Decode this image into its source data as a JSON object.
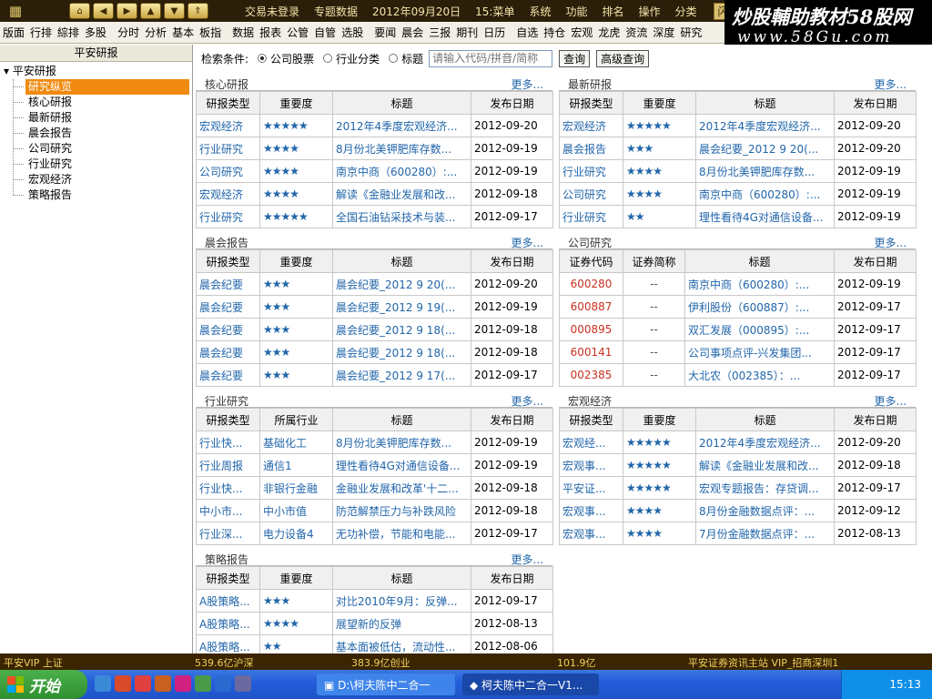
{
  "topbar": {
    "nav_icons": [
      "home-icon",
      "arrow-left-icon",
      "arrow-right-icon",
      "arrow-up-icon",
      "arrow-down-icon",
      "double-up-icon"
    ],
    "menu": [
      "交易未登录",
      "专题数据",
      "2012年09月20日",
      "15:菜单",
      "系统",
      "功能",
      "排名",
      "操作",
      "分类"
    ],
    "flash": "闪电手"
  },
  "toolbar": {
    "items": [
      "版面",
      "行排",
      "綜排",
      "多股",
      "分时",
      "分析",
      "基本",
      "板指",
      "数据",
      "报表",
      "公管",
      "自管",
      "选股",
      "要闻",
      "晨会",
      "三报",
      "期刊",
      "日历",
      "自选",
      "持仓",
      "宏观",
      "龙虎",
      "资流",
      "深度",
      "研究"
    ]
  },
  "watermark": {
    "line1": "炒股輔助教材58股网",
    "line2": "www.58Gu.com"
  },
  "sidebar": {
    "header": "平安研报",
    "root": "平安研报",
    "items": [
      "研究纵览",
      "核心研报",
      "最新研报",
      "晨会报告",
      "公司研究",
      "行业研究",
      "宏观经济",
      "策略报告"
    ],
    "selected": 0
  },
  "search": {
    "label": "检索条件:",
    "options": [
      "公司股票",
      "行业分类",
      "标题"
    ],
    "placeholder": "请输入代码/拼音/简称",
    "query_button": "查询",
    "advanced_button": "高级查询"
  },
  "panels": [
    {
      "title": "核心研报",
      "more": "更多...",
      "headers": [
        "研报类型",
        "重要度",
        "标题",
        "发布日期"
      ],
      "rows": [
        [
          "宏观经济",
          "★★★★★",
          "2012年4季度宏观经济...",
          "2012-09-20"
        ],
        [
          "行业研究",
          "★★★★",
          "8月份北美钾肥库存数...",
          "2012-09-19"
        ],
        [
          "公司研究",
          "★★★★",
          "南京中商（600280）:...",
          "2012-09-19"
        ],
        [
          "宏观经济",
          "★★★★",
          "解读《金融业发展和改...",
          "2012-09-18"
        ],
        [
          "行业研究",
          "★★★★★",
          "全国石油钻采技术与装...",
          "2012-09-17"
        ]
      ]
    },
    {
      "title": "最新研报",
      "more": "更多...",
      "headers": [
        "研报类型",
        "重要度",
        "标题",
        "发布日期"
      ],
      "rows": [
        [
          "宏观经济",
          "★★★★★",
          "2012年4季度宏观经济...",
          "2012-09-20"
        ],
        [
          "晨会报告",
          "★★★",
          "晨会纪要_2012 9 20(...",
          "2012-09-20"
        ],
        [
          "行业研究",
          "★★★★",
          "8月份北美钾肥库存数...",
          "2012-09-19"
        ],
        [
          "公司研究",
          "★★★★",
          "南京中商（600280）:...",
          "2012-09-19"
        ],
        [
          "行业研究",
          "★★",
          "理性看待4G对通信设备...",
          "2012-09-19"
        ]
      ]
    },
    {
      "title": "晨会报告",
      "more": "更多...",
      "headers": [
        "研报类型",
        "重要度",
        "标题",
        "发布日期"
      ],
      "rows": [
        [
          "晨会纪要",
          "★★★",
          "晨会纪要_2012 9 20(...",
          "2012-09-20"
        ],
        [
          "晨会纪要",
          "★★★",
          "晨会纪要_2012 9 19(...",
          "2012-09-19"
        ],
        [
          "晨会纪要",
          "★★★",
          "晨会纪要_2012 9 18(...",
          "2012-09-18"
        ],
        [
          "晨会纪要",
          "★★★",
          "晨会纪要_2012 9 18(...",
          "2012-09-18"
        ],
        [
          "晨会纪要",
          "★★★",
          "晨会纪要_2012 9 17(...",
          "2012-09-17"
        ]
      ]
    },
    {
      "title": "公司研究",
      "more": "更多...",
      "headers": [
        "证券代码",
        "证券简称",
        "标题",
        "发布日期"
      ],
      "rows": [
        [
          "600280",
          "--",
          "南京中商（600280）:...",
          "2012-09-19"
        ],
        [
          "600887",
          "--",
          "伊利股份（600887）:...",
          "2012-09-17"
        ],
        [
          "000895",
          "--",
          "双汇发展（000895）:...",
          "2012-09-17"
        ],
        [
          "600141",
          "--",
          "公司事项点评-兴发集团...",
          "2012-09-17"
        ],
        [
          "002385",
          "--",
          "大北农（002385）：...",
          "2012-09-17"
        ]
      ]
    },
    {
      "title": "行业研究",
      "more": "更多...",
      "headers": [
        "研报类型",
        "所属行业",
        "标题",
        "发布日期"
      ],
      "rows": [
        [
          "行业快...",
          "基础化工",
          "8月份北美钾肥库存数...",
          "2012-09-19"
        ],
        [
          "行业周报",
          "通信1",
          "理性看待4G对通信设备...",
          "2012-09-19"
        ],
        [
          "行业快...",
          "非银行金融",
          "金融业发展和改革'十二...",
          "2012-09-18"
        ],
        [
          "中小市...",
          "中小市值",
          "防范解禁压力与补跌风险",
          "2012-09-18"
        ],
        [
          "行业深...",
          "电力设备4",
          "无功补偿，节能和电能...",
          "2012-09-17"
        ]
      ]
    },
    {
      "title": "宏观经济",
      "more": "更多...",
      "headers": [
        "研报类型",
        "重要度",
        "标题",
        "发布日期"
      ],
      "rows": [
        [
          "宏观经...",
          "★★★★★",
          "2012年4季度宏观经济...",
          "2012-09-20"
        ],
        [
          "宏观事...",
          "★★★★★",
          "解读《金融业发展和改...",
          "2012-09-18"
        ],
        [
          "平安证...",
          "★★★★★",
          "宏观专题报告：存贷调...",
          "2012-09-17"
        ],
        [
          "宏观事...",
          "★★★★",
          "8月份金融数据点评：...",
          "2012-09-12"
        ],
        [
          "宏观事...",
          "★★★★",
          "7月份金融数据点评：...",
          "2012-08-13"
        ]
      ]
    },
    {
      "title": "策略报告",
      "more": "更多...",
      "headers": [
        "研报类型",
        "重要度",
        "标题",
        "发布日期"
      ],
      "rows": [
        [
          "A股策略...",
          "★★★",
          "对比2010年9月：反弹...",
          "2012-09-17"
        ],
        [
          "A股策略...",
          "★★★★",
          "展望新的反弹",
          "2012-08-13"
        ],
        [
          "A股策略...",
          "★★",
          "基本面被低估，流动性...",
          "2012-08-06"
        ]
      ]
    }
  ],
  "statusbar": {
    "left": "平安VIP 上证",
    "v1": "539.6亿沪深",
    "v2": "383.9亿创业",
    "v3": "101.9亿",
    "right": "平安证券资讯主站 VIP_招商深圳1"
  },
  "taskbar": {
    "start": "开始",
    "tasks": [
      "D:\\柯夫陈中二合一",
      "柯夫陈中二合一V1..."
    ],
    "clock": "15:13"
  }
}
